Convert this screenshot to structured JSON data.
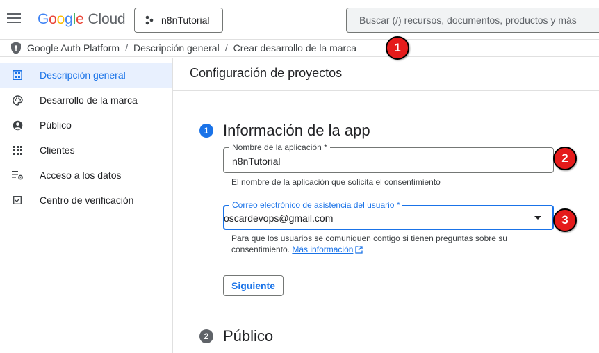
{
  "header": {
    "logo_letters": [
      "G",
      "o",
      "o",
      "g",
      "l",
      "e"
    ],
    "logo_suffix": "Cloud",
    "project": "n8nTutorial",
    "search_placeholder": "Buscar (/) recursos, documentos, productos y más"
  },
  "breadcrumb": {
    "items": [
      "Google Auth Platform",
      "Descripción general",
      "Crear desarrollo de la marca"
    ],
    "separator": "/"
  },
  "markers": [
    "1",
    "2",
    "3"
  ],
  "sidebar": {
    "items": [
      {
        "label": "Descripción general",
        "icon": "dashboard-icon",
        "active": true
      },
      {
        "label": "Desarrollo de la marca",
        "icon": "palette-icon",
        "active": false
      },
      {
        "label": "Público",
        "icon": "account-circle-icon",
        "active": false
      },
      {
        "label": "Clientes",
        "icon": "apps-grid-icon",
        "active": false
      },
      {
        "label": "Acceso a los datos",
        "icon": "data-settings-icon",
        "active": false
      },
      {
        "label": "Centro de verificación",
        "icon": "checkbox-icon",
        "active": false
      }
    ]
  },
  "main": {
    "title": "Configuración de proyectos",
    "step1": {
      "number": "1",
      "title": "Información de la app",
      "app_name_label": "Nombre de la aplicación *",
      "app_name_value": "n8nTutorial",
      "app_name_hint": "El nombre de la aplicación que solicita el consentimiento",
      "email_label": "Correo electrónico de asistencia del usuario *",
      "email_value": "oscardevops@gmail.com",
      "email_hint_line1": "Para que los usuarios se comuniquen contigo si tienen preguntas sobre su",
      "email_hint_line2": "consentimiento.",
      "more_info_link": "Más información",
      "next_button": "Siguiente"
    },
    "step2": {
      "number": "2",
      "title": "Público"
    }
  },
  "colors": {
    "accent": "#1a73e8",
    "active_bg": "#e8f0fe",
    "marker_red": "#e51b1b",
    "step_inactive": "#5f6368"
  }
}
